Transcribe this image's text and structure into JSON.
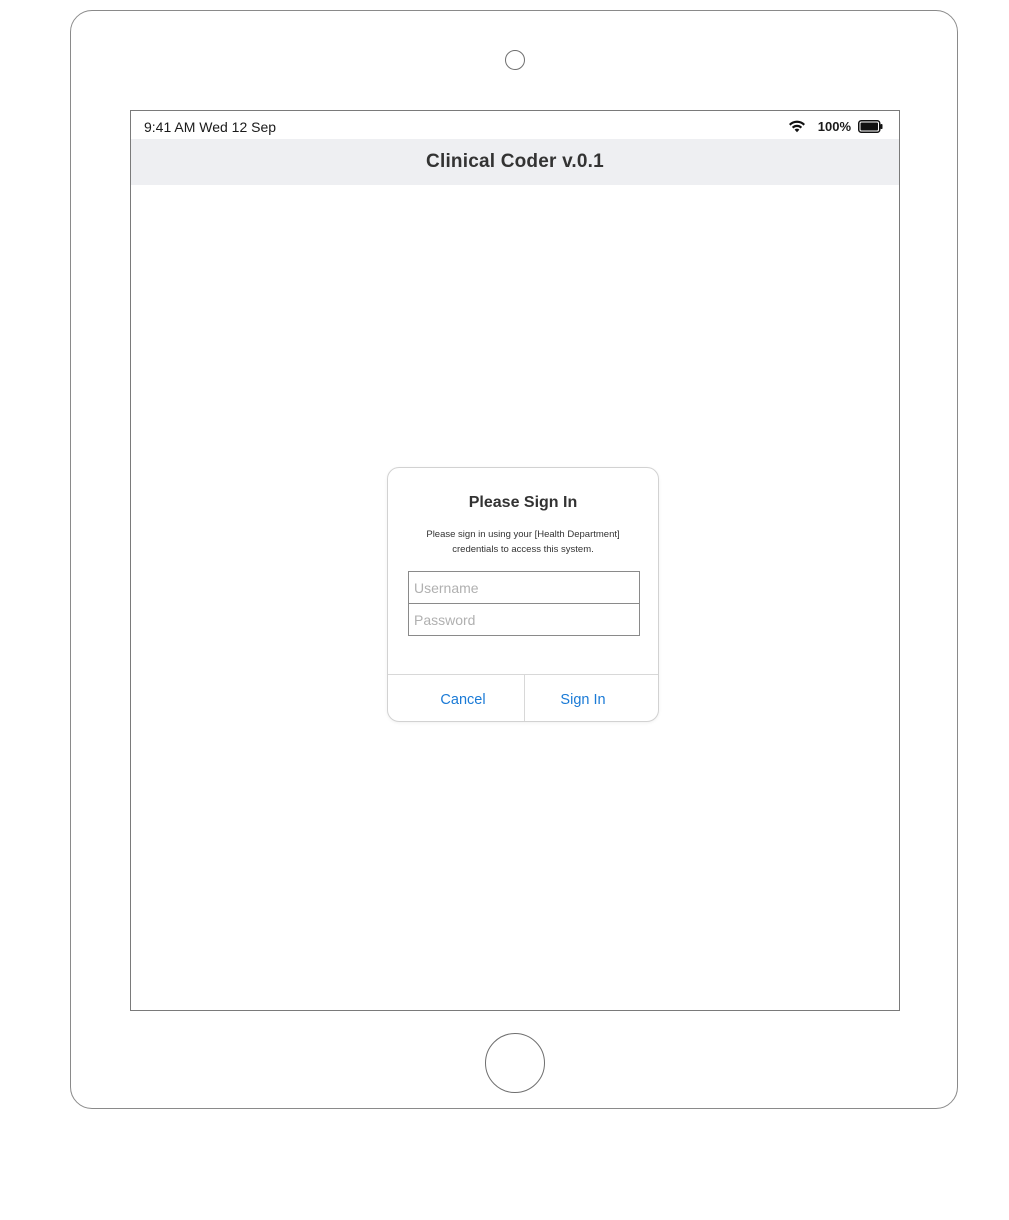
{
  "status_bar": {
    "time": "9:41 AM  Wed 12 Sep",
    "battery_percent": "100%",
    "wifi_icon": "wifi-icon",
    "battery_icon": "battery-full-icon"
  },
  "nav_bar": {
    "title": "Clinical Coder v.0.1"
  },
  "dialog": {
    "title": "Please Sign In",
    "message": "Please sign in using your [Health Department] credentials to access this system.",
    "username": {
      "placeholder": "Username",
      "value": ""
    },
    "password": {
      "placeholder": "Password",
      "value": ""
    },
    "cancel_label": "Cancel",
    "sign_in_label": "Sign In",
    "button_color": "#1a7ad6"
  },
  "colors": {
    "nav_background": "#eeeff2",
    "text_primary": "#333333",
    "accent": "#1a7ad6"
  }
}
